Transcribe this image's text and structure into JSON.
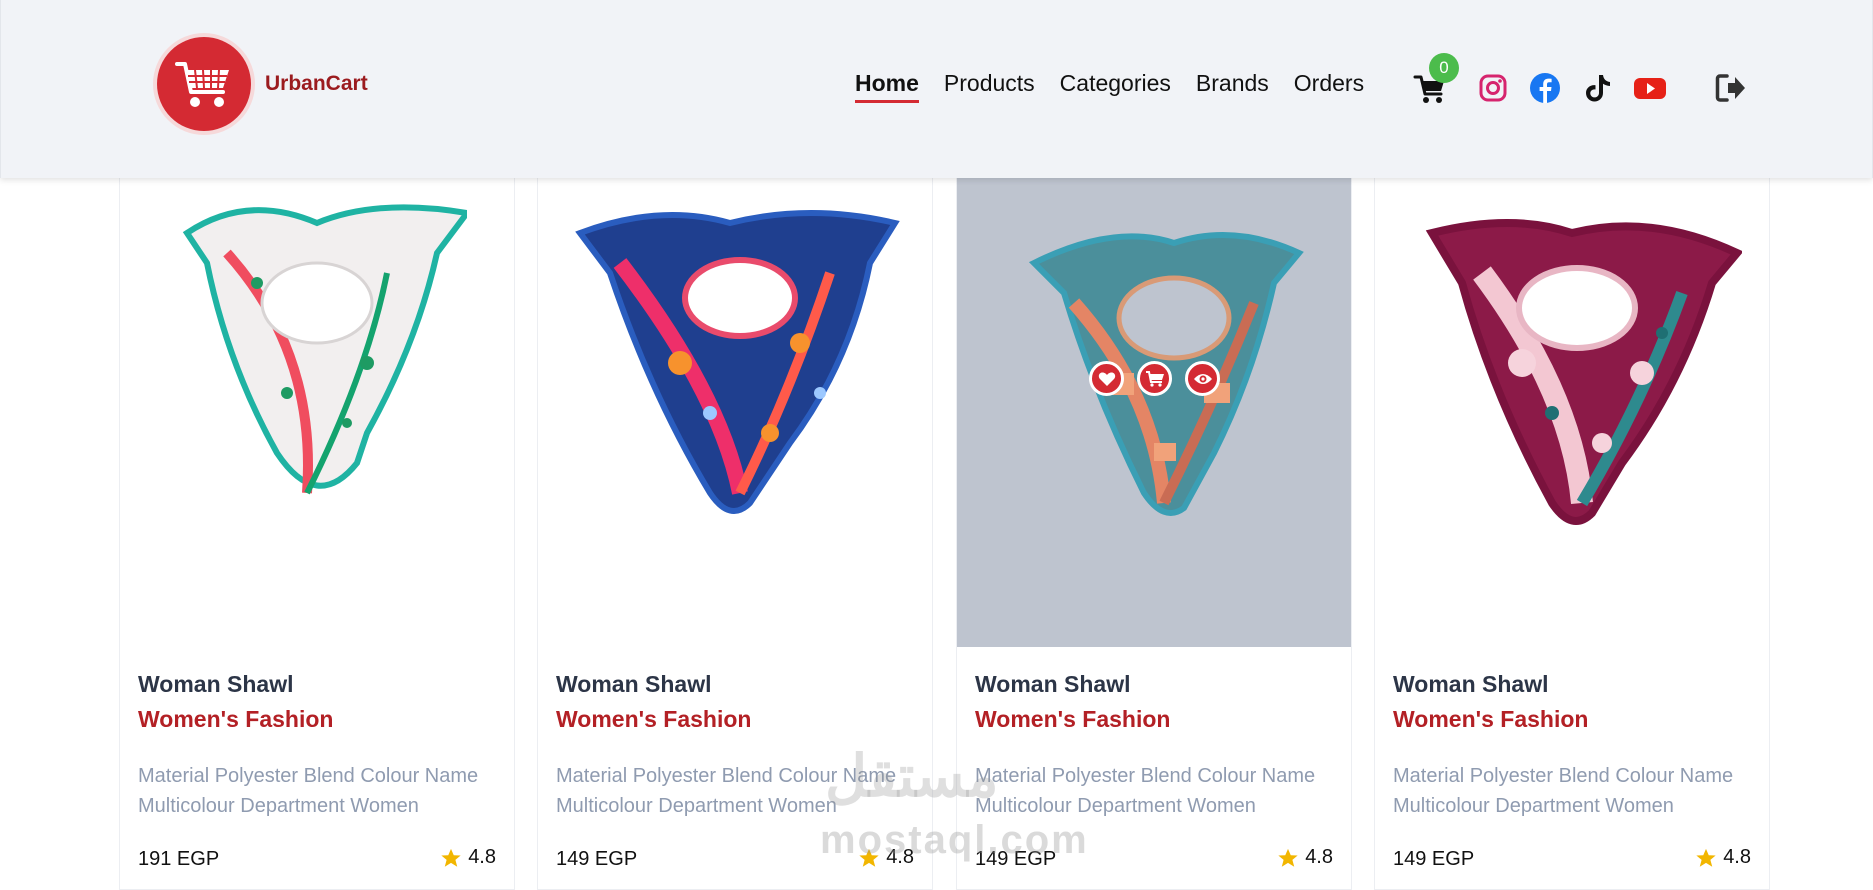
{
  "brand": {
    "name": "UrbanCart"
  },
  "nav": {
    "items": [
      {
        "label": "Home",
        "active": true
      },
      {
        "label": "Products",
        "active": false
      },
      {
        "label": "Categories",
        "active": false
      },
      {
        "label": "Brands",
        "active": false
      },
      {
        "label": "Orders",
        "active": false
      }
    ]
  },
  "cart": {
    "count": "0",
    "icon": "cart-icon"
  },
  "social": [
    "instagram-icon",
    "facebook-icon",
    "tiktok-icon",
    "youtube-icon"
  ],
  "logout": {
    "icon": "logout-icon"
  },
  "products": [
    {
      "title": "Woman Shawl",
      "category": "Women's Fashion",
      "description": "Material Polyester Blend Colour Name Multicolour Department Women",
      "price": "191 EGP",
      "rating": "4.8"
    },
    {
      "title": "Woman Shawl",
      "category": "Women's Fashion",
      "description": "Material Polyester Blend Colour Name Multicolour Department Women",
      "price": "149 EGP",
      "rating": "4.8"
    },
    {
      "title": "Woman Shawl",
      "category": "Women's Fashion",
      "description": "Material Polyester Blend Colour Name Multicolour Department Women",
      "price": "149 EGP",
      "rating": "4.8"
    },
    {
      "title": "Woman Shawl",
      "category": "Women's Fashion",
      "description": "Material Polyester Blend Colour Name Multicolour Department Women",
      "price": "149 EGP",
      "rating": "4.8"
    }
  ],
  "hover_actions": [
    "heart-icon",
    "cart-icon",
    "eye-icon"
  ],
  "watermark": {
    "arabic": "مستقل",
    "latin": "mostaql.com"
  },
  "colors": {
    "accent": "#d42a33",
    "badge": "#4cbc4c",
    "star": "#f2b600"
  }
}
